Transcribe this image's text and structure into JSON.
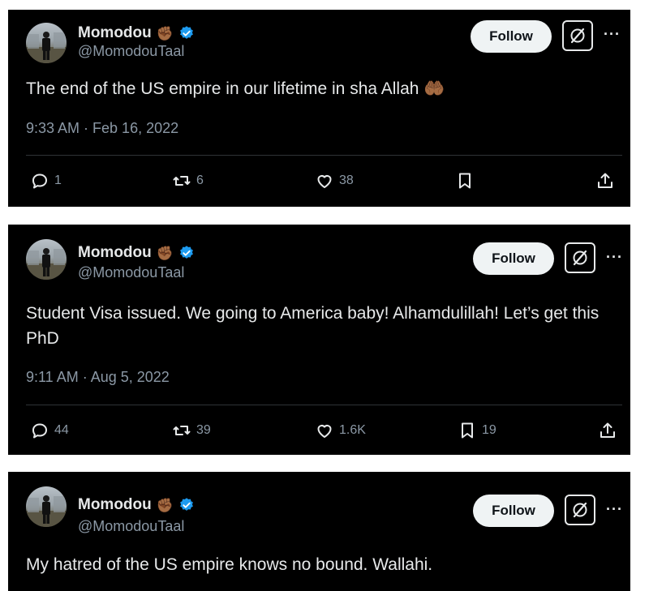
{
  "tweets": [
    {
      "author_name": "Momodou",
      "fist_emoji": "✊🏾",
      "handle": "@MomodouTaal",
      "follow_label": "Follow",
      "more_label": "···",
      "text": "The end of the US empire in our lifetime in sha Allah 🤲🏾",
      "timestamp": "9:33 AM · Feb 16, 2022",
      "replies": "1",
      "reposts": "6",
      "likes": "38",
      "bookmarks": ""
    },
    {
      "author_name": "Momodou",
      "fist_emoji": "✊🏾",
      "handle": "@MomodouTaal",
      "follow_label": "Follow",
      "more_label": "···",
      "text": "Student Visa issued. We going to America baby! Alhamdulillah! Let’s get this PhD",
      "timestamp": "9:11 AM · Aug 5, 2022",
      "replies": "44",
      "reposts": "39",
      "likes": "1.6K",
      "bookmarks": "19"
    },
    {
      "author_name": "Momodou",
      "fist_emoji": "✊🏾",
      "handle": "@MomodouTaal",
      "follow_label": "Follow",
      "more_label": "···",
      "text": "My hatred of the US empire knows no bound. Wallahi."
    }
  ],
  "colors": {
    "card_bg": "#000000",
    "text": "#e7e9ea",
    "muted": "#8b98a5",
    "verified": "#1d9bf0",
    "follow_bg": "#eff3f4"
  },
  "icons": [
    "avatar",
    "fist-emoji",
    "verified-badge-icon",
    "grok-icon",
    "more-icon",
    "reply-icon",
    "repost-icon",
    "like-icon",
    "bookmark-icon",
    "share-icon"
  ]
}
